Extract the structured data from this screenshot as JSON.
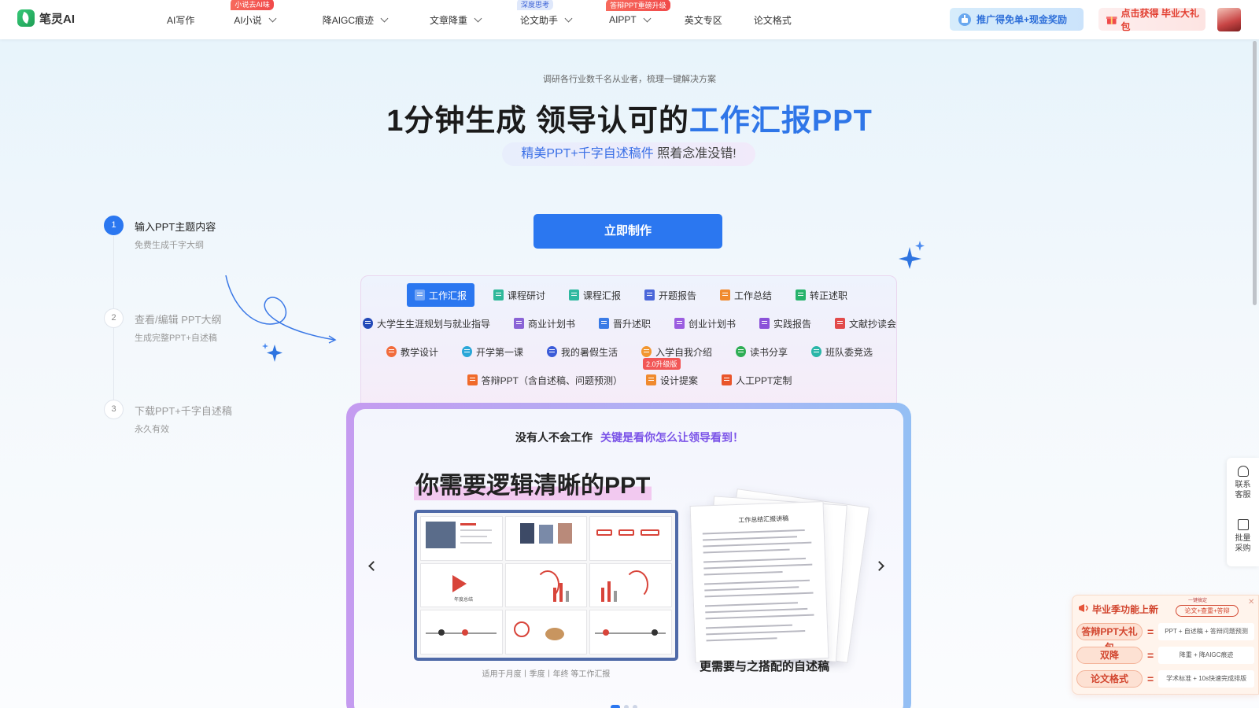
{
  "app": {
    "logo_text": "笔灵AI"
  },
  "nav": {
    "items": [
      {
        "label": "AI写作",
        "has_menu": false,
        "badge": ""
      },
      {
        "label": "AI小说",
        "has_menu": true,
        "badge": "小说去AI味"
      },
      {
        "label": "降AIGC痕迹",
        "has_menu": true,
        "badge": ""
      },
      {
        "label": "文章降重",
        "has_menu": true,
        "badge": ""
      },
      {
        "label": "论文助手",
        "has_menu": true,
        "badge": "深度思考"
      },
      {
        "label": "AIPPT",
        "has_menu": true,
        "badge": "答辩PPT重磅升级"
      },
      {
        "label": "英文专区",
        "has_menu": false,
        "badge": ""
      },
      {
        "label": "论文格式",
        "has_menu": false,
        "badge": ""
      }
    ],
    "promo_referral": "推广得免单+现金奖励",
    "promo_gift": "点击获得 毕业大礼包"
  },
  "hero": {
    "subtitle": "调研各行业数千名从业者，梳理一键解决方案",
    "headline_prefix": "1分钟生成 领导认可的",
    "headline_highlight": "工作汇报",
    "headline_suffix": "PPT",
    "pill_highlight": "精美PPT+千字自述稿件",
    "pill_rest": " 照着念准没错!",
    "cta_label": "立即制作"
  },
  "steps": [
    {
      "num": "1",
      "title": "输入PPT主题内容",
      "sub": "免费生成千字大纲"
    },
    {
      "num": "2",
      "title": "查看/编辑 PPT大纲",
      "sub": "生成完整PPT+自述稿"
    },
    {
      "num": "3",
      "title": "下载PPT+千字自述稿",
      "sub": "永久有效"
    }
  ],
  "categories": {
    "row1": [
      "工作汇报",
      "课程研讨",
      "课程汇报",
      "开题报告",
      "工作总结",
      "转正述职"
    ],
    "row2": [
      "大学生生涯规划与就业指导",
      "商业计划书",
      "晋升述职",
      "创业计划书",
      "实践报告",
      "文献抄读会"
    ],
    "row3": [
      "教学设计",
      "开学第一课",
      "我的暑假生活",
      "入学自我介绍",
      "读书分享",
      "班队委竞选"
    ],
    "row4": [
      "答辩PPT（含自述稿、问题预测）",
      "设计提案",
      "人工PPT定制"
    ],
    "upgrade_badge": "2.0升级版",
    "colors": [
      "#2b77f0",
      "#2fb89a",
      "#2fb8a0",
      "#4a66d9",
      "#f08a2e",
      "#27b36c",
      "#2349b8",
      "#8a63d6",
      "#3a7be6",
      "#9b5de0",
      "#8b52d9",
      "#e24b4b",
      "#f26c3c",
      "#2aa7d8",
      "#3b5bd8",
      "#f2962f",
      "#2fae55",
      "#2ab6a8",
      "#f06a2a",
      "#f08a2e",
      "#e9552b"
    ]
  },
  "showcase": {
    "tag_plain": "没有人不会工作",
    "tag_highlight": "关键是看你怎么让领导看到！",
    "title": "你需要逻辑清晰的PPT",
    "preview_caption": "适用于月度丨季度丨年终 等工作汇报",
    "doc_caption": "更需要与之搭配的自述稿",
    "doc_header": "工作总结汇报讲稿",
    "slide_cover_text": "年度总结"
  },
  "side_tools": {
    "contact": "联系客服",
    "bulk": "批量采购"
  },
  "grad_promo": {
    "title": "毕业季功能上新",
    "pill": "论文+查重+答辩",
    "mini": "一键搞定",
    "rows": [
      {
        "tag": "答辩PPT大礼包",
        "desc": "PPT + 自述稿 + 答辩问题预测"
      },
      {
        "tag": "双降",
        "desc": "降重 + 降AIGC痕迹"
      },
      {
        "tag": "论文格式",
        "desc": "学术标准 + 10s快速完成排版"
      }
    ]
  }
}
